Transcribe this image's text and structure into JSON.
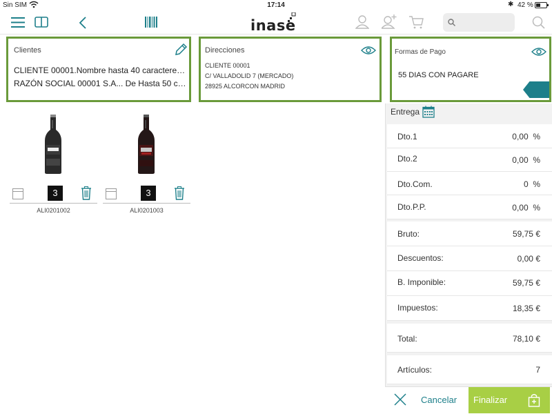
{
  "status_bar": {
    "carrier": "Sin SIM",
    "time": "17:14",
    "battery_text": "42 %",
    "battery_level": 0.42
  },
  "toolbar": {
    "logo": "inase",
    "search_placeholder": "",
    "icons": [
      "menu-icon",
      "book-icon",
      "back-chevron-icon",
      "barcode-icon",
      "user-icon",
      "add-user-icon",
      "cart-icon",
      "search-icon"
    ],
    "accent_color": "#1d7f8a"
  },
  "clientes": {
    "title": "Clientes",
    "line1": "CLIENTE 00001.Nombre hasta 40 caracteres...",
    "line2": "RAZÓN SOCIAL  00001 S.A... De  Hasta 50 ca..."
  },
  "direcciones": {
    "title": "Direcciones",
    "line1": "CLIENTE 00001",
    "line2": "C/ VALLADOLID 7 (MERCADO)",
    "line3": "28925 ALCORCON MADRID"
  },
  "formas_pago": {
    "title": "Formas de Pago",
    "value": "55 DIAS CON PAGARE"
  },
  "products": [
    {
      "code": "ALI0201002",
      "qty": "3"
    },
    {
      "code": "ALI0201003",
      "qty": "3"
    }
  ],
  "summary": {
    "entrega_label": "Entrega",
    "dto1": {
      "label": "Dto.1",
      "value": "0,00",
      "unit": "%"
    },
    "dto2": {
      "label": "Dto.2",
      "value": "0,00",
      "unit": "%"
    },
    "dto_com": {
      "label": "Dto.Com.",
      "value": "0",
      "unit": "%"
    },
    "dto_pp": {
      "label": "Dto.P.P.",
      "value": "0,00",
      "unit": "%"
    },
    "bruto": {
      "label": "Bruto:",
      "value": "59,75 €"
    },
    "descuentos": {
      "label": "Descuentos:",
      "value": "0,00 €"
    },
    "imponible": {
      "label": "B. Imponible:",
      "value": "59,75 €"
    },
    "impuestos": {
      "label": "Impuestos:",
      "value": "18,35 €"
    },
    "total": {
      "label": "Total:",
      "value": "78,10 €"
    },
    "articulos": {
      "label": "Artículos:",
      "value": "7"
    }
  },
  "footer": {
    "cancel_label": "Cancelar",
    "finalize_label": "Finalizar",
    "finalize_color": "#a8cf45"
  },
  "colors": {
    "panel_border": "#6a9a3a",
    "accent": "#1d7f8a"
  }
}
